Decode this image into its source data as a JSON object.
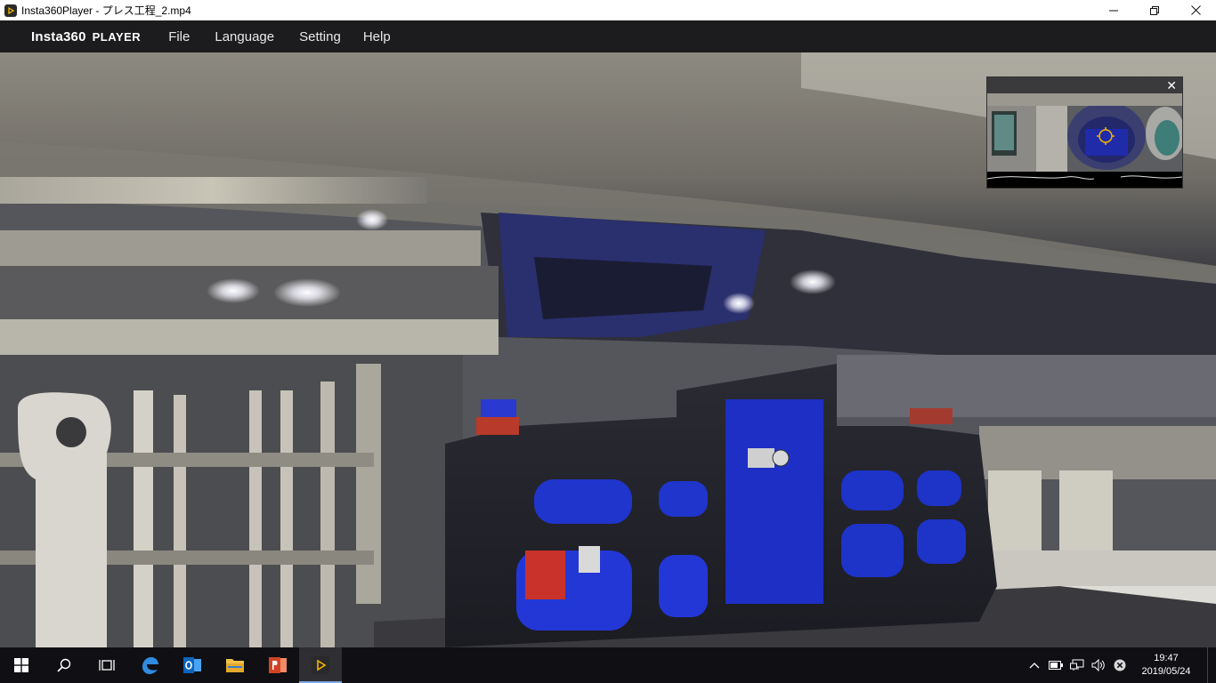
{
  "window": {
    "title": "Insta360Player - プレス工程_2.mp4",
    "minimize_glyph": "—",
    "maximize_glyph": "❐",
    "close_glyph": "✕"
  },
  "menubar": {
    "brand_main": "Insta360",
    "brand_sub": "PLAYER",
    "items": [
      "File",
      "Language",
      "Setting",
      "Help"
    ]
  },
  "minimap": {
    "close_glyph": "✕"
  },
  "taskbar": {
    "icons": [
      "windows-start-icon",
      "search-icon",
      "task-view-icon",
      "edge-icon",
      "outlook-icon",
      "file-explorer-icon",
      "powerpoint-icon",
      "insta360-player-icon"
    ],
    "tray_icons": [
      "chevron-up-icon",
      "battery-icon",
      "network-icon",
      "volume-icon",
      "close-circle-icon"
    ],
    "time": "19:47",
    "date": "2019/05/24"
  },
  "colors": {
    "menubar_bg": "#1c1c1e",
    "taskbar_bg": "#101014",
    "fixture_blue": "#1d2fc4",
    "accent": "#f2b400"
  }
}
